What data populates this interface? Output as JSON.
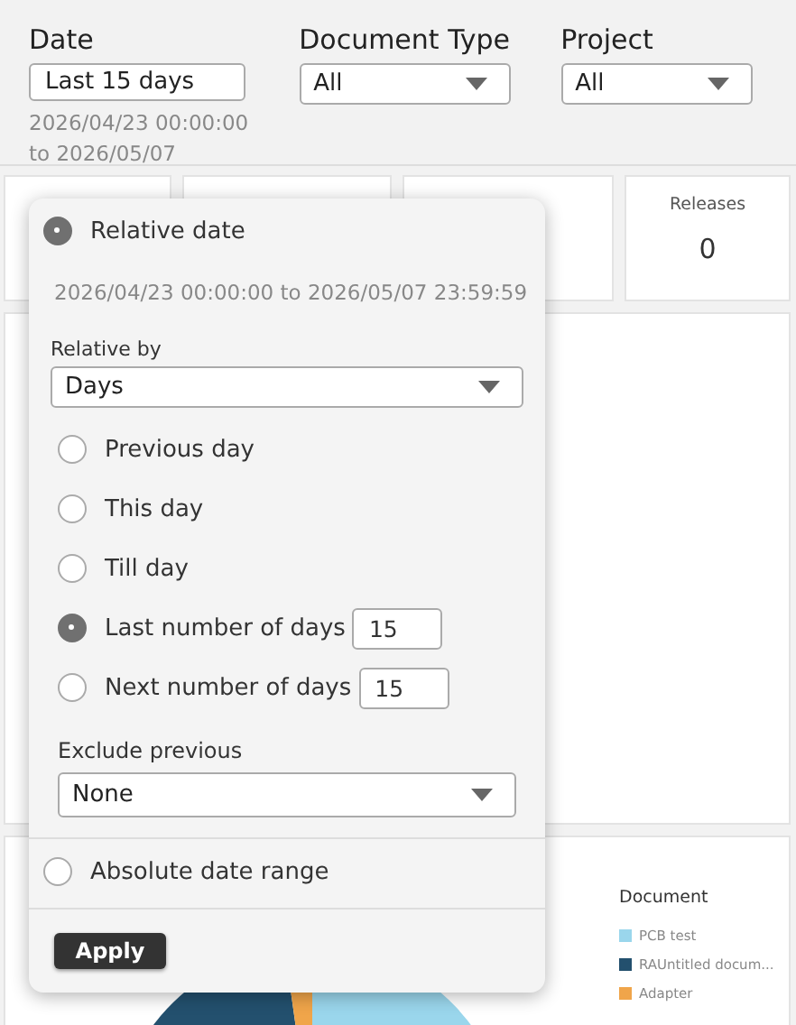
{
  "filters": [
    {
      "kind": "date",
      "label": "Date",
      "value": "Last 15 days",
      "range_lines": [
        "2026/04/23 00:00:00",
        "to 2026/05/07"
      ]
    },
    {
      "kind": "select",
      "label": "Document Type",
      "value": "All"
    },
    {
      "kind": "select",
      "label": "Project",
      "value": "All"
    }
  ],
  "cards": [
    {
      "kind": "blank"
    },
    {
      "kind": "blank"
    },
    {
      "kind": "blank"
    },
    {
      "kind": "metric",
      "label": "Releases",
      "value": "0"
    }
  ],
  "pie_panel": {
    "legend_title": "Document",
    "legend": [
      {
        "label": "PCB test",
        "color": "#9ad6ec"
      },
      {
        "label": "RAUntitled docum...",
        "color": "#23506e"
      },
      {
        "label": "Adapter",
        "color": "#f0a54a"
      }
    ]
  },
  "date_popup": {
    "relative": {
      "label": "Relative date",
      "selected": true,
      "range_text": "2026/04/23 00:00:00 to 2026/05/07 23:59:59",
      "relative_by": {
        "label": "Relative by",
        "value": "Days"
      },
      "options": [
        {
          "label": "Previous day",
          "selected": false
        },
        {
          "label": "This day",
          "selected": false
        },
        {
          "label": "Till day",
          "selected": false
        },
        {
          "label": "Last number of days",
          "selected": true,
          "value": "15"
        },
        {
          "label": "Next number of days",
          "selected": false,
          "value": "15"
        }
      ],
      "exclude": {
        "label": "Exclude previous",
        "value": "None"
      }
    },
    "absolute": {
      "label": "Absolute date range",
      "selected": false
    },
    "apply": "Apply"
  }
}
